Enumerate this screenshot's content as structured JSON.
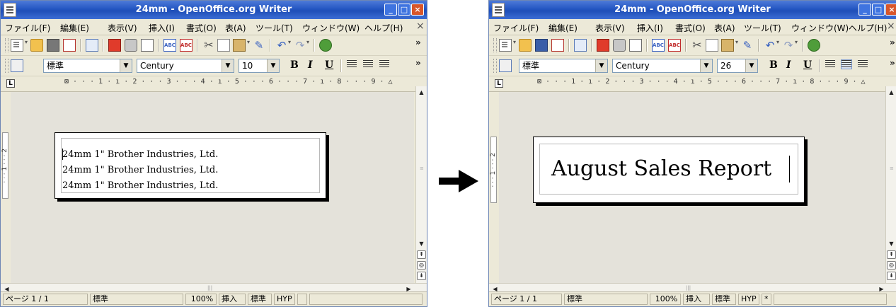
{
  "windows": [
    {
      "title": "24mm - OpenOffice.org Writer",
      "menu": [
        "ファイル(F)",
        "編集(E)",
        "表示(V)",
        "挿入(I)",
        "書式(O)",
        "表(A)",
        "ツール(T)",
        "ウィンドウ(W)",
        "ヘルプ(H)"
      ],
      "menu_close": "×",
      "paragraph_style": "標準",
      "font_name": "Century",
      "font_size": "10",
      "bold": "B",
      "italic": "I",
      "underline": "U",
      "ruler_text": "⊠ · · · 1 · ı · 2 · · · 3 · · · 4 · ı · 5 · · · 6 · · · 7 · ı · 8 · · · 9 · △",
      "vruler_text": "· · · 1 · · · 2",
      "lines": [
        "24mm  1\"  Brother Industries, Ltd.",
        "24mm  1\"  Brother Industries, Ltd.",
        "24mm  1\"  Brother Industries, Ltd."
      ],
      "status": {
        "page": "ページ 1 / 1",
        "style": "標準",
        "zoom": "100%",
        "insert_mode": "挿入",
        "selection_mode": "標準",
        "hyphenation": "HYP",
        "modified": ""
      }
    },
    {
      "title": "24mm - OpenOffice.org Writer",
      "menu": [
        "ファイル(F)",
        "編集(E)",
        "表示(V)",
        "挿入(I)",
        "書式(O)",
        "表(A)",
        "ツール(T)",
        "ウィンドウ(W)",
        "ヘルプ(H)"
      ],
      "menu_close": "×",
      "paragraph_style": "標準",
      "font_name": "Century",
      "font_size": "26",
      "bold": "B",
      "italic": "I",
      "underline": "U",
      "ruler_text": "⊠ · · · 1 · ı · 2 · · · 3 · · · 4 · ı · 5 · · · 6 · · · 7 · ı · 8 · · · 9 · △",
      "vruler_text": "· · · 1 · · · 2",
      "big_text": "August Sales Report",
      "status": {
        "page": "ページ 1 / 1",
        "style": "標準",
        "zoom": "100%",
        "insert_mode": "挿入",
        "selection_mode": "標準",
        "hyphenation": "HYP",
        "modified": "*"
      }
    }
  ],
  "arrow": "→",
  "colors": {
    "titlebar": "#2456c2",
    "window_bg": "#ece9d8",
    "doc_bg": "#e4e2da",
    "close_button": "#d8562a"
  }
}
